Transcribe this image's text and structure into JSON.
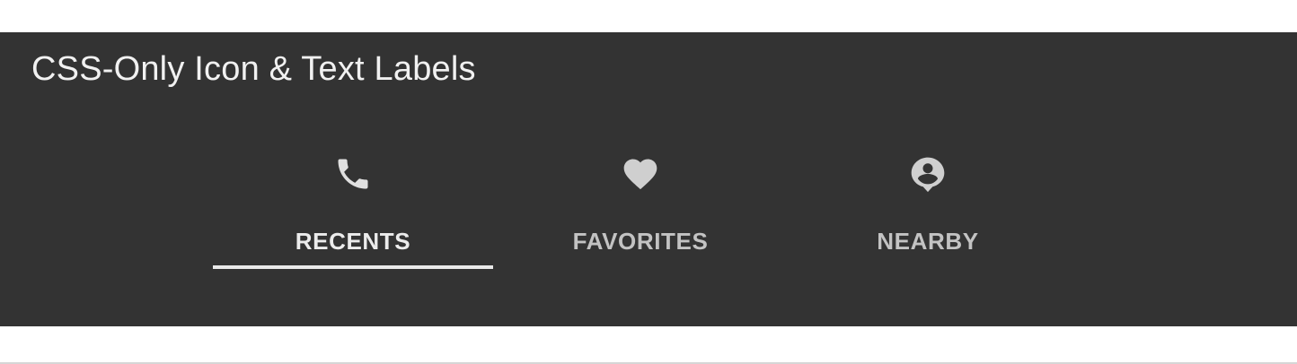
{
  "panel": {
    "title": "CSS-Only Icon & Text Labels"
  },
  "tabs": [
    {
      "label": "RECENTS",
      "icon": "phone-icon",
      "active": true
    },
    {
      "label": "FAVORITES",
      "icon": "heart-icon",
      "active": false
    },
    {
      "label": "NEARBY",
      "icon": "person-pin-icon",
      "active": false
    }
  ],
  "colors": {
    "panel_background": "#333333",
    "title_text": "#f1f1f1",
    "active_label": "#ececec",
    "inactive_label": "#c3c3c3",
    "icon": "#d9d9d9",
    "active_indicator": "#e9e9e9"
  }
}
